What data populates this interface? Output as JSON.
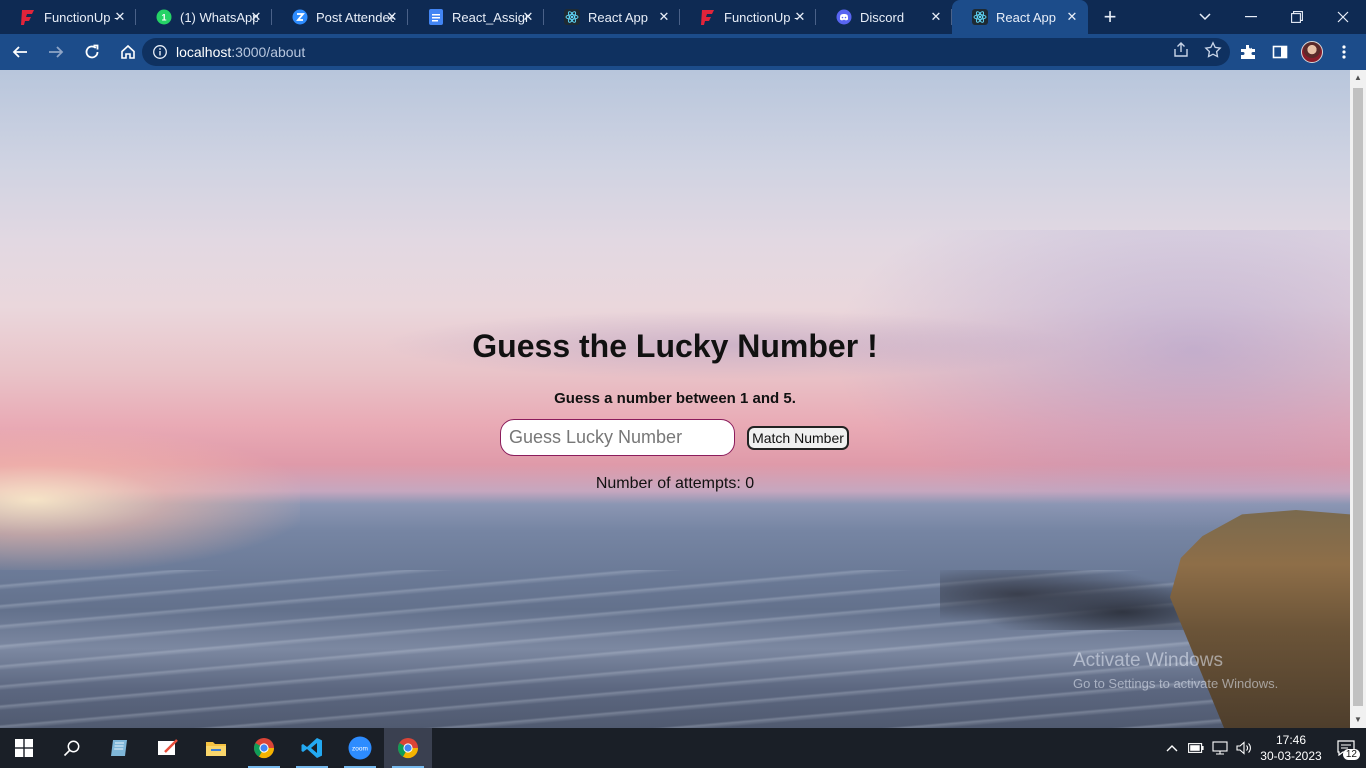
{
  "browser": {
    "tabs": [
      {
        "title": "FunctionUp -",
        "favicon": "functionup-icon",
        "color": "#e2243a"
      },
      {
        "title": "(1) WhatsApp",
        "favicon": "whatsapp-icon",
        "color": "#25d366"
      },
      {
        "title": "Post Attendee",
        "favicon": "zoom-z-icon",
        "color": "#2d8cff"
      },
      {
        "title": "React_Assignm",
        "favicon": "docs-icon",
        "color": "#4285f4"
      },
      {
        "title": "React App",
        "favicon": "react-icon",
        "color": "#61dafb"
      },
      {
        "title": "FunctionUp -",
        "favicon": "functionup-icon",
        "color": "#e2243a"
      },
      {
        "title": "Discord",
        "favicon": "discord-icon",
        "color": "#5865f2"
      },
      {
        "title": "React App",
        "favicon": "react-icon",
        "color": "#61dafb"
      }
    ],
    "active_tab": 7,
    "new_tab_label": "+",
    "url_host": "localhost",
    "url_path": ":3000/about"
  },
  "page": {
    "heading": "Guess the Lucky Number !",
    "subheading": "Guess a number between 1 and 5.",
    "input_placeholder": "Guess Lucky Number",
    "input_value": "",
    "button_label": "Match Number",
    "attempts_label": "Number of attempts: ",
    "attempts_count": "0"
  },
  "watermark": {
    "title": "Activate Windows",
    "subtitle": "Go to Settings to activate Windows."
  },
  "taskbar": {
    "apps": [
      "windows-start-icon",
      "search-icon",
      "notes-icon",
      "whiteboard-icon",
      "file-explorer-icon",
      "chrome-icon",
      "vscode-icon",
      "zoom-icon",
      "chrome-icon"
    ],
    "time": "17:46",
    "date": "30-03-2023",
    "notification_count": "12"
  }
}
